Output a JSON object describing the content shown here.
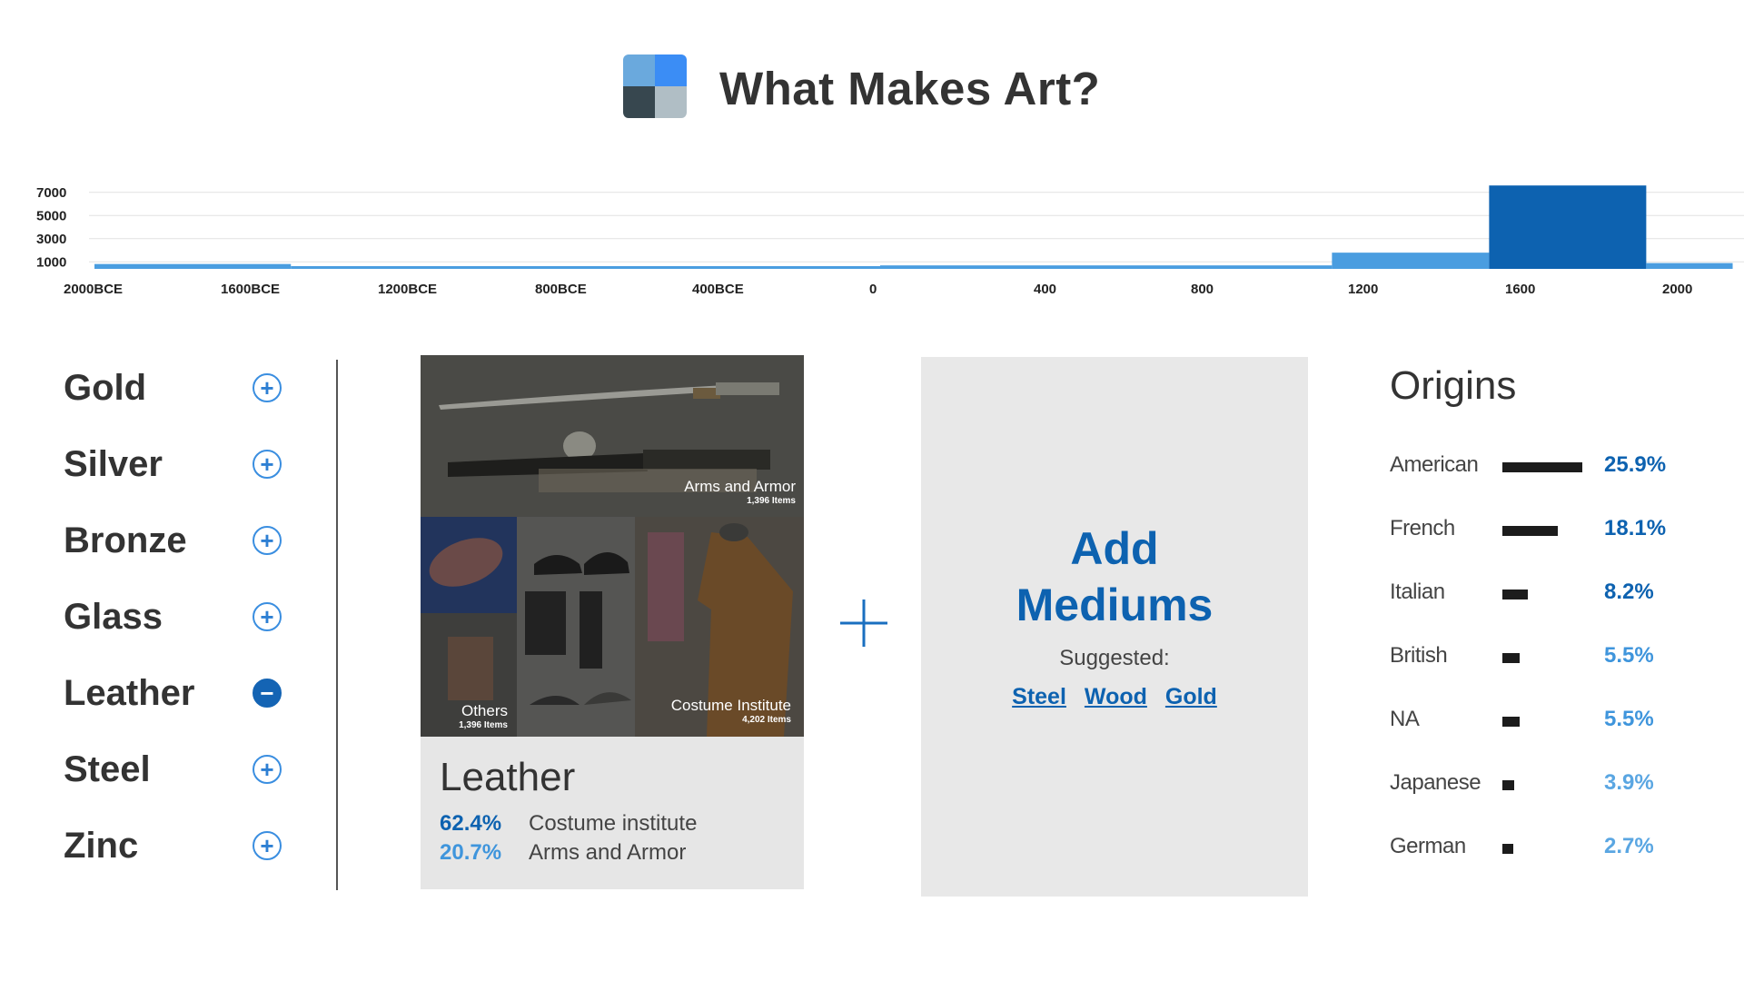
{
  "header": {
    "title": "What Makes Art?",
    "logo_colors": [
      "#6aa9dd",
      "#3b8df5",
      "#37474f",
      "#b0bec5"
    ]
  },
  "chart_data": {
    "type": "bar",
    "title": "",
    "xlabel": "",
    "ylabel": "",
    "y_tick_labels": [
      "7000",
      "5000",
      "3000",
      "1000"
    ],
    "x_tick_labels": [
      "2000BCE",
      "1600BCE",
      "1200BCE",
      "800BCE",
      "400BCE",
      "0",
      "400",
      "800",
      "1200",
      "1600",
      "2000"
    ],
    "ylim": [
      0,
      8000
    ],
    "grid": true,
    "bins": [
      {
        "start": -2000,
        "end": -1500,
        "value": 420
      },
      {
        "start": -1500,
        "end": -1200,
        "value": 120
      },
      {
        "start": -1200,
        "end": 0,
        "value": 60
      },
      {
        "start": 0,
        "end": 1150,
        "value": 300
      },
      {
        "start": 1150,
        "end": 1550,
        "value": 1400
      },
      {
        "start": 1550,
        "end": 1950,
        "value": 7200
      },
      {
        "start": 1950,
        "end": 2170,
        "value": 500
      }
    ],
    "bar_color": "#4a9de0",
    "highlight_color": "#0d62b0",
    "highlight_bin": 5
  },
  "materials": [
    {
      "label": "Gold",
      "state": "add"
    },
    {
      "label": "Silver",
      "state": "add"
    },
    {
      "label": "Bronze",
      "state": "add"
    },
    {
      "label": "Glass",
      "state": "add"
    },
    {
      "label": "Leather",
      "state": "remove"
    },
    {
      "label": "Steel",
      "state": "add"
    },
    {
      "label": "Zinc",
      "state": "add"
    }
  ],
  "card": {
    "title": "Leather",
    "tiles": [
      {
        "name": "Arms and Armor",
        "count": "1,396 Items"
      },
      {
        "name": "Others",
        "count": "1,396 Items"
      },
      {
        "name": "Costume Institute",
        "count": "4,202 Items"
      }
    ],
    "stats": [
      {
        "pct": "62.4%",
        "label": "Costume institute",
        "color": "#0d62b0"
      },
      {
        "pct": "20.7%",
        "label": "Arms and Armor",
        "color": "#3f95dc"
      }
    ]
  },
  "add_mediums": {
    "title_line1": "Add",
    "title_line2": "Mediums",
    "suggested_label": "Suggested:",
    "suggestions": [
      "Steel",
      "Wood",
      "Gold"
    ]
  },
  "origins": {
    "title": "Origins",
    "rows": [
      {
        "name": "American",
        "pct": "25.9%",
        "value": 25.9,
        "color": "#0d62b0"
      },
      {
        "name": "French",
        "pct": "18.1%",
        "value": 18.1,
        "color": "#0d62b0"
      },
      {
        "name": "Italian",
        "pct": "8.2%",
        "value": 8.2,
        "color": "#0d62b0"
      },
      {
        "name": "British",
        "pct": "5.5%",
        "value": 5.5,
        "color": "#3f95dc"
      },
      {
        "name": "NA",
        "pct": "5.5%",
        "value": 5.5,
        "color": "#3f95dc"
      },
      {
        "name": "Japanese",
        "pct": "3.9%",
        "value": 3.9,
        "color": "#5aa6e2"
      },
      {
        "name": "German",
        "pct": "2.7%",
        "value": 2.7,
        "color": "#5aa6e2"
      }
    ]
  }
}
